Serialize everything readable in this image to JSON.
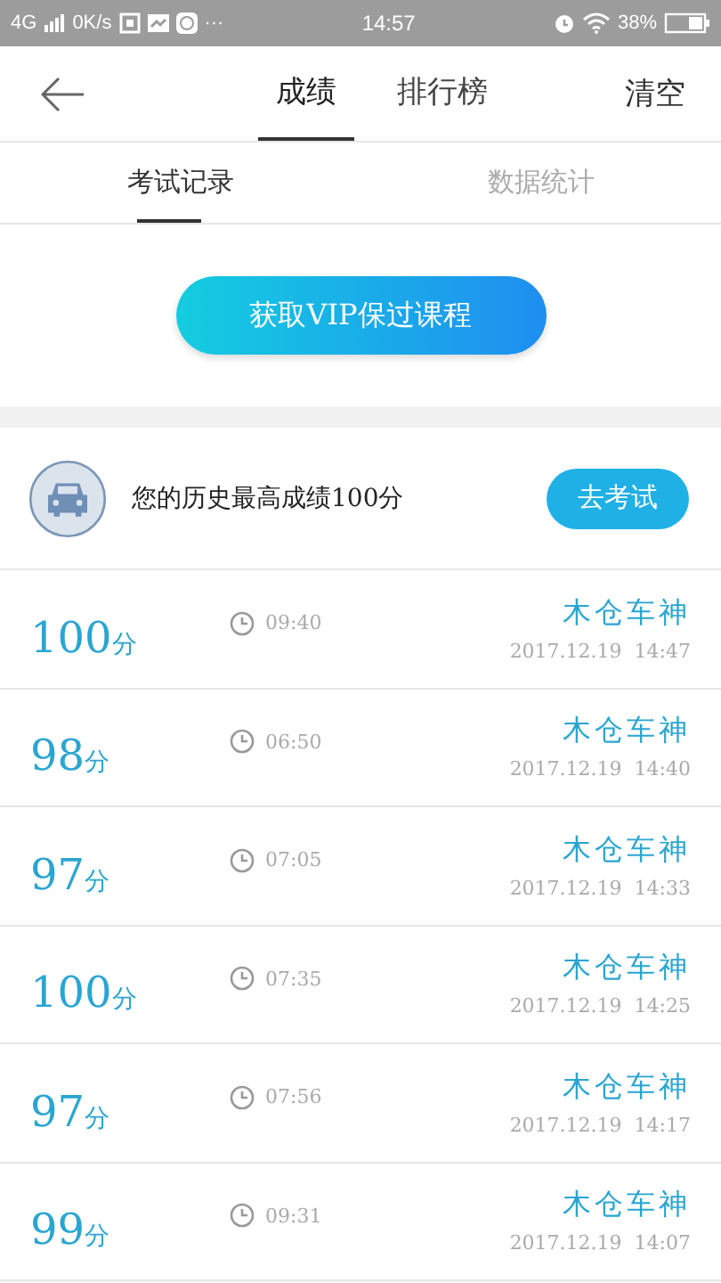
{
  "status_bar": {
    "network": "4G",
    "speed": "0K/s",
    "more": "···",
    "time": "14:57",
    "battery": "38%"
  },
  "header": {
    "tabs": [
      {
        "label": "成绩",
        "selected": true
      },
      {
        "label": "排行榜",
        "selected": false
      }
    ],
    "action": "清空"
  },
  "sub_tabs": [
    {
      "label": "考试记录",
      "selected": true
    },
    {
      "label": "数据统计",
      "selected": false
    }
  ],
  "vip_button": "获取VIP保过课程",
  "best": {
    "text": "您的历史最高成绩100分",
    "button": "去考试"
  },
  "records": [
    {
      "score": "100",
      "unit": "分",
      "duration": "09:40",
      "title": "木仓车神",
      "date": "2017.12.19  14:47"
    },
    {
      "score": "98",
      "unit": "分",
      "duration": "06:50",
      "title": "木仓车神",
      "date": "2017.12.19  14:40"
    },
    {
      "score": "97",
      "unit": "分",
      "duration": "07:05",
      "title": "木仓车神",
      "date": "2017.12.19  14:33"
    },
    {
      "score": "100",
      "unit": "分",
      "duration": "07:35",
      "title": "木仓车神",
      "date": "2017.12.19  14:25"
    },
    {
      "score": "97",
      "unit": "分",
      "duration": "07:56",
      "title": "木仓车神",
      "date": "2017.12.19  14:17"
    },
    {
      "score": "99",
      "unit": "分",
      "duration": "09:31",
      "title": "木仓车神",
      "date": "2017.12.19  14:07"
    }
  ]
}
